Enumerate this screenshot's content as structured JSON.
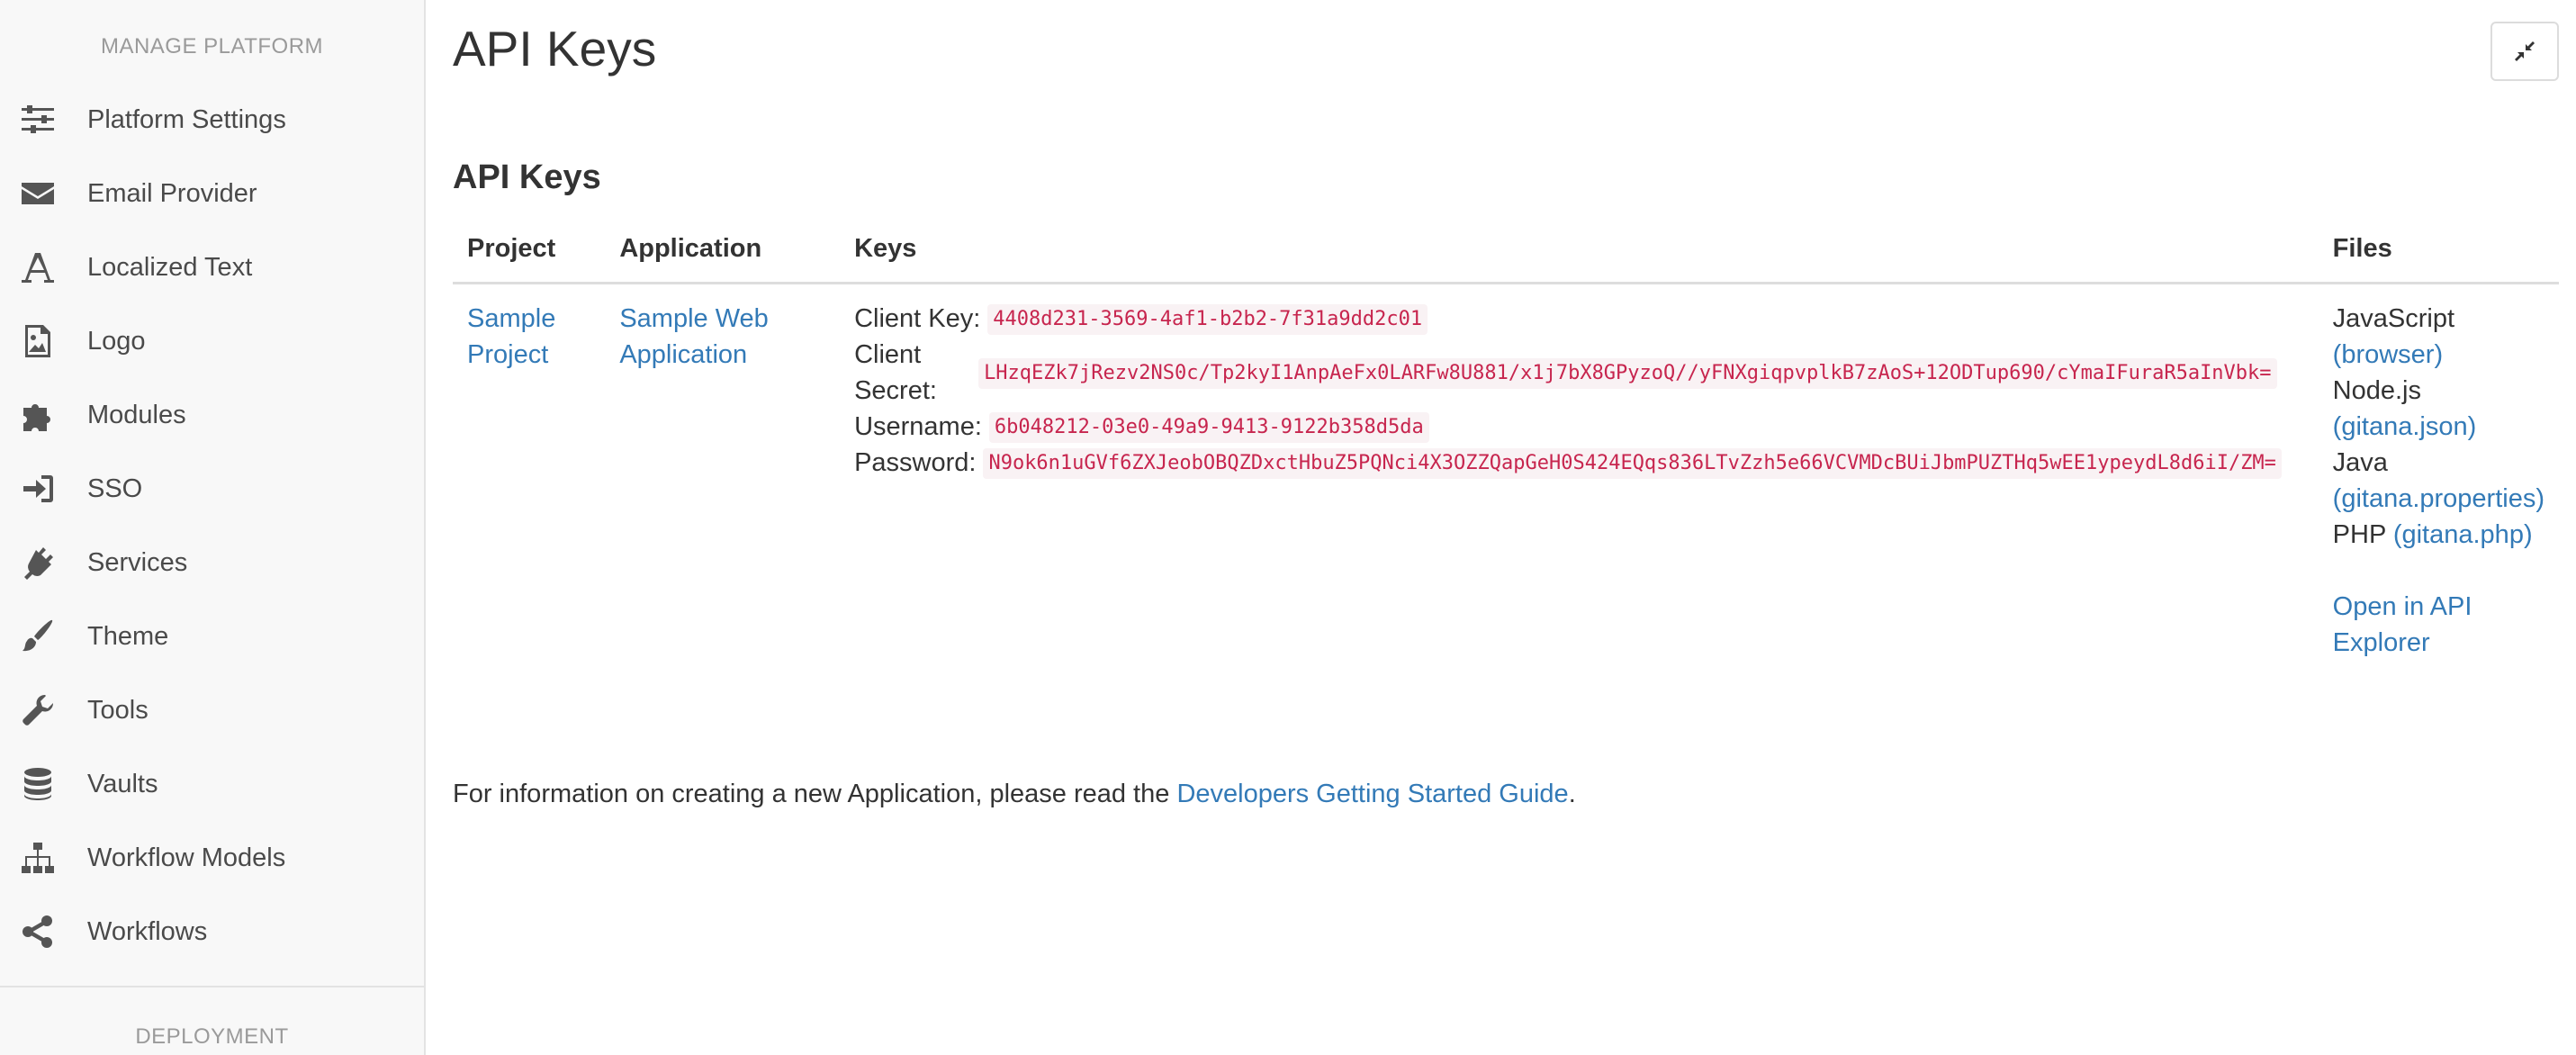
{
  "sidebar": {
    "heading_top": "MANAGE PLATFORM",
    "heading_bottom": "DEPLOYMENT",
    "items": [
      {
        "label": "Platform Settings",
        "icon": "sliders-icon"
      },
      {
        "label": "Email Provider",
        "icon": "envelope-icon"
      },
      {
        "label": "Localized Text",
        "icon": "font-icon"
      },
      {
        "label": "Logo",
        "icon": "image-icon"
      },
      {
        "label": "Modules",
        "icon": "puzzle-icon"
      },
      {
        "label": "SSO",
        "icon": "sign-in-icon"
      },
      {
        "label": "Services",
        "icon": "plug-icon"
      },
      {
        "label": "Theme",
        "icon": "paint-brush-icon"
      },
      {
        "label": "Tools",
        "icon": "wrench-icon"
      },
      {
        "label": "Vaults",
        "icon": "database-icon"
      },
      {
        "label": "Workflow Models",
        "icon": "sitemap-icon"
      },
      {
        "label": "Workflows",
        "icon": "share-icon"
      }
    ]
  },
  "main": {
    "title": "API Keys",
    "section_title": "API Keys",
    "collapse_icon": "compress-icon",
    "table": {
      "headers": [
        "Project",
        "Application",
        "Keys",
        "Files"
      ],
      "row": {
        "project": "Sample Project",
        "application": "Sample Web Application",
        "keys": {
          "client_key_label": "Client Key:",
          "client_key": "4408d231-3569-4af1-b2b2-7f31a9dd2c01",
          "client_secret_label": "Client Secret:",
          "client_secret": "LHzqEZk7jRezv2NS0c/Tp2kyI1AnpAeFx0LARFw8U881/x1j7bX8GPyzoQ//yFNXgiqpvplkB7zAoS+12ODTup690/cYmaIFuraR5aInVbk=",
          "username_label": "Username:",
          "username": "6b048212-03e0-49a9-9413-9122b358d5da",
          "password_label": "Password:",
          "password": "N9ok6n1uGVf6ZXJeobOBQZDxctHbuZ5PQNci4X3OZZQapGeH0S424EQqs836LTvZzh5e66VCVMDcBUiJbmPUZTHq5wEE1ypeydL8d6iI/ZM="
        },
        "files": {
          "javascript_label": "JavaScript",
          "javascript_link": "(browser)",
          "node_label": "Node.js",
          "node_link": "(gitana.json)",
          "java_label": "Java",
          "java_link": "(gitana.properties)",
          "php_label": "PHP",
          "php_link": "(gitana.php)",
          "explorer_link": "Open in API Explorer"
        }
      }
    },
    "info_text": "For information on creating a new Application, please read the",
    "info_link": "Developers Getting Started Guide",
    "info_suffix": "."
  },
  "colors": {
    "link": "#337ab7",
    "code_text": "#c7254e",
    "code_bg": "#f9f2f4",
    "sidebar_bg": "#f8f8f8"
  }
}
